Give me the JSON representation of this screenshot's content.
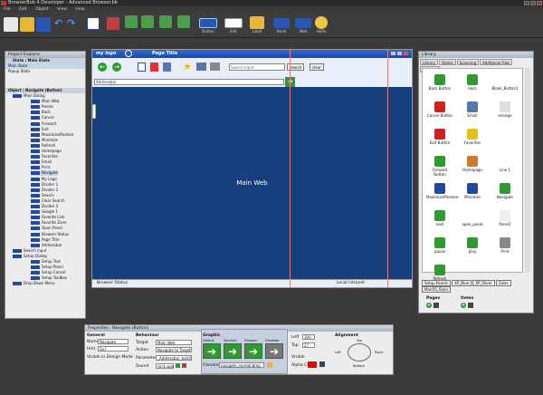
{
  "app": {
    "title": "BrowserBob 4 Developer - Advanced Browser.bb"
  },
  "menu": [
    "File",
    "Edit",
    "Object",
    "View",
    "Help"
  ],
  "toolbar": {
    "labels": [
      "Button",
      "Edit",
      "Label",
      "Panel",
      "Web",
      "Hello"
    ]
  },
  "project_explorer": {
    "title": "Project Explorer",
    "state_header": "State : Main State",
    "states": [
      "Main State",
      "Popup State"
    ],
    "object_header": "Object : Navigate (Button)",
    "tree": [
      "Main Dialog",
      "Main Web",
      "Resize",
      "Back",
      "Cancel",
      "Forward",
      "Exit",
      "Maximize/Restore",
      "Minimize",
      "Refresh",
      "Homepage",
      "Favorites",
      "Email",
      "Print",
      "Navigate",
      "My Logo",
      "Divider 1",
      "Divider 2",
      "Search",
      "Clear Search",
      "Divider 3",
      "Google 1",
      "Favorite Link",
      "Favorite Zone",
      "Open Panel",
      "Browser Status",
      "Page Title",
      "Addressbar",
      "Search input",
      "Setup Dialog",
      "Setup Text",
      "Setup Panel",
      "Setup Cancel",
      "Setup Toolbox",
      "Drop Down Menu"
    ]
  },
  "browser": {
    "logo": "my logo",
    "page_title": "Page Title",
    "search_placeholder": "Search Input",
    "search_btn": "search",
    "clear_btn": "clear",
    "address": "Addressbar",
    "main_label": "Main Web",
    "status": "Browser Status",
    "zone": "Local intranet"
  },
  "library": {
    "title": "Library",
    "tabs": [
      "Library",
      "States",
      "Scanning",
      "Additional Files",
      "Content"
    ],
    "items": [
      {
        "label": "Back Button",
        "color": "#2f9a2f"
      },
      {
        "label": "back",
        "color": "#2f9a2f"
      },
      {
        "label": "Blank_Button1",
        "color": "#ffffff"
      },
      {
        "label": "Cancel Button",
        "color": "#cc2222"
      },
      {
        "label": "Email",
        "color": "#5577aa"
      },
      {
        "label": "enlarge",
        "color": "#ddd"
      },
      {
        "label": "Exit Button",
        "color": "#cc2222"
      },
      {
        "label": "Favorites",
        "color": "#e6c020"
      },
      {
        "label": "",
        "color": "transparent"
      },
      {
        "label": "Forward Button",
        "color": "#2f9a2f"
      },
      {
        "label": "Homepage",
        "color": "#cc7733"
      },
      {
        "label": "Line 1",
        "color": "#fff"
      },
      {
        "label": "Maximize/Restore",
        "color": "#27479a"
      },
      {
        "label": "Minimize",
        "color": "#27479a"
      },
      {
        "label": "Navigate",
        "color": "#2f9a2f"
      },
      {
        "label": "next",
        "color": "#2f9a2f"
      },
      {
        "label": "open_panel",
        "color": "#fff"
      },
      {
        "label": "Panel2",
        "color": "#eee"
      },
      {
        "label": "pause",
        "color": "#2f9a2f"
      },
      {
        "label": "play",
        "color": "#2f9a2f"
      },
      {
        "label": "Print",
        "color": "#888"
      },
      {
        "label": "Refresh",
        "color": "#2f9a2f"
      }
    ],
    "styles": [
      "Setup Panels",
      "XP_Blue",
      "XP_Silver",
      "Sinks",
      "MacOS_Style"
    ],
    "pages_label": "Pages",
    "items_label": "Items"
  },
  "properties": {
    "title": "Properties : Navigate (Button)",
    "general": {
      "header": "General",
      "name_label": "Name",
      "name_value": "Navigate",
      "hint_label": "Hint",
      "hint_value": "Go!",
      "visible_label": "Visible in Design Mode"
    },
    "behaviour": {
      "header": "Behaviour",
      "target_label": "Target",
      "target_value": "Main Web",
      "action_label": "Action",
      "action_value": "Navigate to Target",
      "param_label": "Parameter",
      "param_value": "_Addressbar_text()",
      "sound_label": "Sound",
      "sound_value": "click.wav"
    },
    "graphic": {
      "header": "Graphic",
      "states": [
        "Default",
        "Touched",
        "Pressed",
        "Disabled"
      ],
      "file_label": "Filename",
      "file_value": "navigate_normal.bmp",
      "alpha_label": "Alpha Color"
    },
    "geometry": {
      "left_label": "Left",
      "left_value": "300",
      "top_label": "Top",
      "top_value": "27",
      "visible_label": "Visible"
    },
    "alignment": {
      "header": "Alignment",
      "top": "Top",
      "left": "Left",
      "right": "Right",
      "bottom": "Bottom"
    }
  }
}
